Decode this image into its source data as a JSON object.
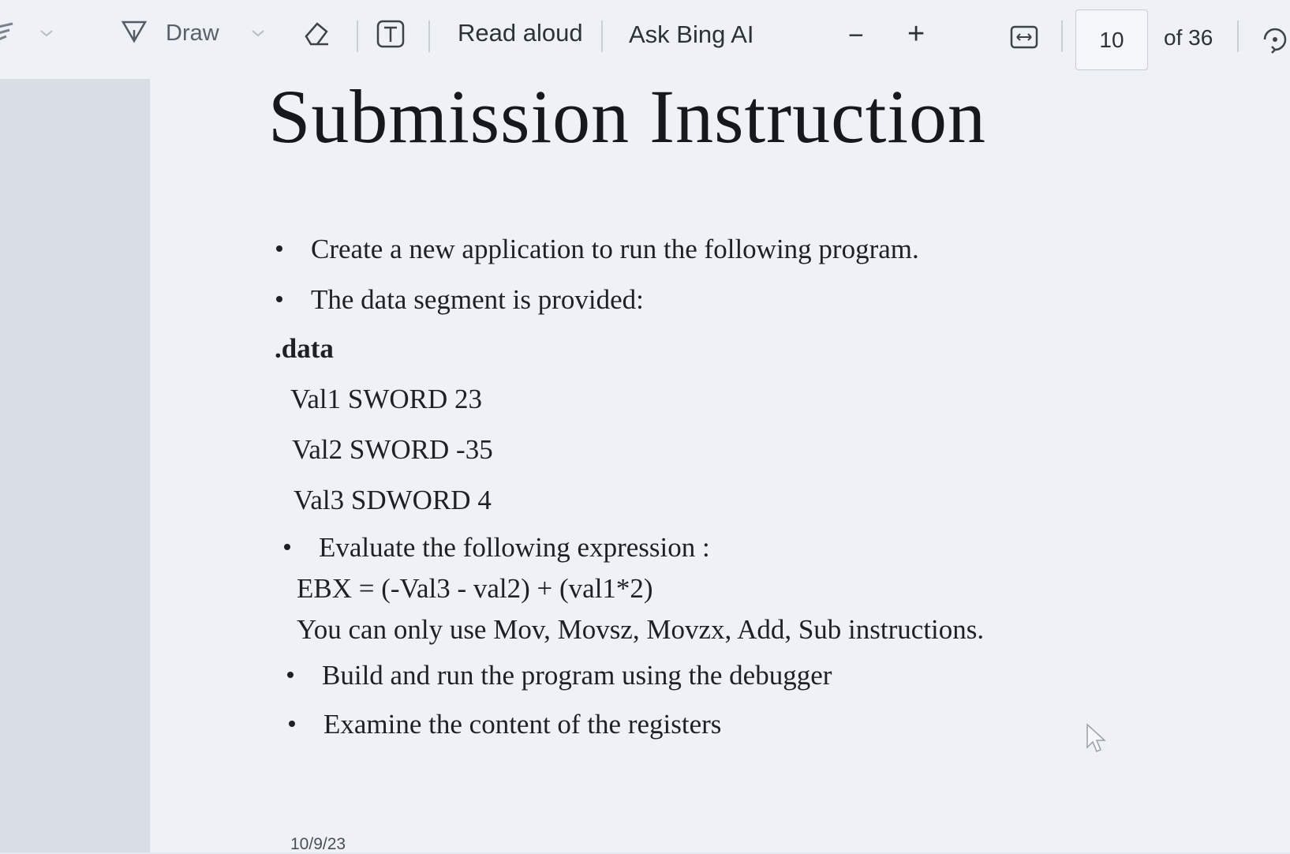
{
  "toolbar": {
    "draw_label": "Draw",
    "read_aloud_label": "Read aloud",
    "ask_bing_label": "Ask Bing AI",
    "zoom_out": "−",
    "zoom_in": "+",
    "page_current": "10",
    "page_total": "of 36",
    "icons": [
      "highlighter-icon",
      "draw-icon",
      "chevron-down-icon",
      "eraser-icon",
      "text-box-icon",
      "fit-width-icon",
      "rotate-icon"
    ]
  },
  "document": {
    "title": "Submission Instruction",
    "bullets_top": [
      "Create a new application to run the following program.",
      "The data segment is provided:"
    ],
    "data_header": ".data",
    "data_lines": [
      "Val1 SWORD 23",
      "Val2 SWORD -35",
      "Val3 SDWORD 4"
    ],
    "evaluate_bullet": "Evaluate the following expression :",
    "expression": "EBX = (-Val3 - val2) + (val1*2)",
    "constraint": "You can only use Mov, Movsz, Movzx, Add, Sub instructions.",
    "bullets_bottom": [
      "Build and run the program using the debugger",
      "Examine the content of the registers"
    ],
    "footer_date": "10/9/23"
  }
}
